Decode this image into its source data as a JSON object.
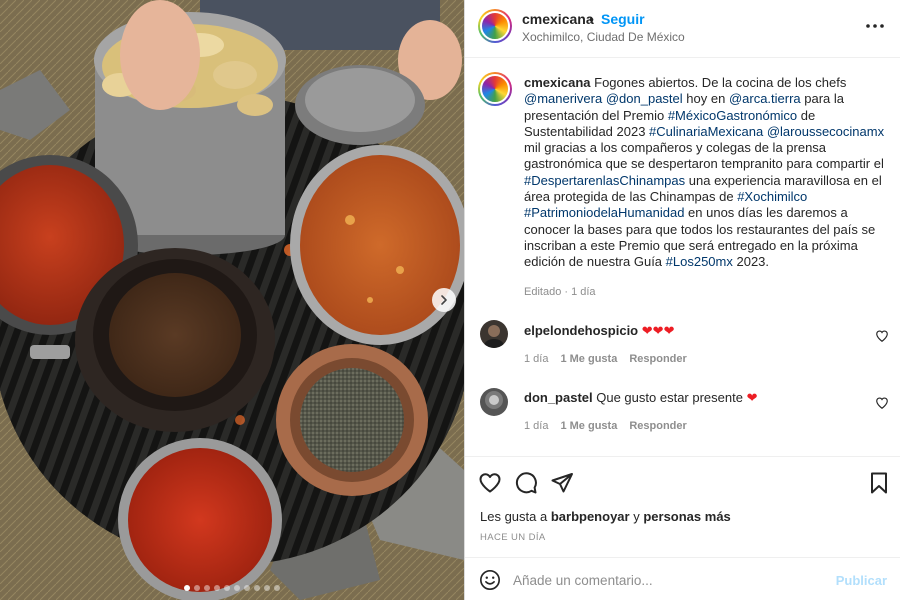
{
  "post": {
    "username": "cmexicana",
    "separator": "•",
    "follow_label": "Seguir",
    "location": "Xochimilco, Ciudad De México"
  },
  "caption": {
    "username": "cmexicana",
    "parts": [
      {
        "t": "Fogones abiertos. De la cocina de los chefs ",
        "tag": false
      },
      {
        "t": "@manerivera",
        "tag": true
      },
      {
        "t": " ",
        "tag": false
      },
      {
        "t": "@don_pastel",
        "tag": true
      },
      {
        "t": " hoy en ",
        "tag": false
      },
      {
        "t": "@arca.tierra",
        "tag": true
      },
      {
        "t": " para la presentación del Premio ",
        "tag": false
      },
      {
        "t": "#MéxicoGastronómico",
        "tag": true
      },
      {
        "t": " de Sustentabilidad 2023 ",
        "tag": false
      },
      {
        "t": "#CulinariaMexicana",
        "tag": true
      },
      {
        "t": " ",
        "tag": false
      },
      {
        "t": "@laroussecocinamx",
        "tag": true
      },
      {
        "t": " mil gracias a los compañeros y colegas de la prensa gastronómica que se despertaron tempranito para compartir el ",
        "tag": false
      },
      {
        "t": "#DespertarenlasChinampas",
        "tag": true
      },
      {
        "t": " una experiencia maravillosa en el área protegida de las Chinampas de ",
        "tag": false
      },
      {
        "t": "#Xochimilco",
        "tag": true
      },
      {
        "t": " ",
        "tag": false
      },
      {
        "t": "#PatrimoniodelaHumanidad",
        "tag": true
      },
      {
        "t": " en unos días les daremos a conocer la bases para que todos los restaurantes del país se inscriban a este Premio que será entregado en la próxima edición de nuestra Guía ",
        "tag": false
      },
      {
        "t": "#Los250mx",
        "tag": true
      },
      {
        "t": " 2023.",
        "tag": false
      }
    ],
    "edited": "Editado · 1 día"
  },
  "comments": [
    {
      "username": "elpelondehospicio",
      "text": "❤️❤️❤️",
      "age": "1 día",
      "likes": "1 Me gusta",
      "reply": "Responder"
    },
    {
      "username": "don_pastel",
      "text": "Que gusto estar presente ❤️",
      "age": "1 día",
      "likes": "1 Me gusta",
      "reply": "Responder"
    }
  ],
  "likes": {
    "prefix": "Les gusta a",
    "user": "barbpenoyar",
    "connector": "y",
    "others": "personas más"
  },
  "timestamp": "HACE UN DÍA",
  "add_comment": {
    "placeholder": "Añade un comentario...",
    "publish_label": "Publicar"
  },
  "carousel": {
    "count": 10,
    "active_index": 0
  },
  "colors": {
    "link": "#0095f6",
    "tag": "#00376b",
    "heart": "#ed1d24",
    "publish_disabled": "#b2dffc"
  },
  "icons": {
    "more": "more-dots-icon",
    "comment_like": "heart-outline-icon",
    "like": "heart-outline-icon",
    "comment": "comment-bubble-icon",
    "share": "paper-plane-icon",
    "save": "bookmark-icon",
    "emoji": "emoji-smile-icon",
    "next": "chevron-right-icon"
  }
}
